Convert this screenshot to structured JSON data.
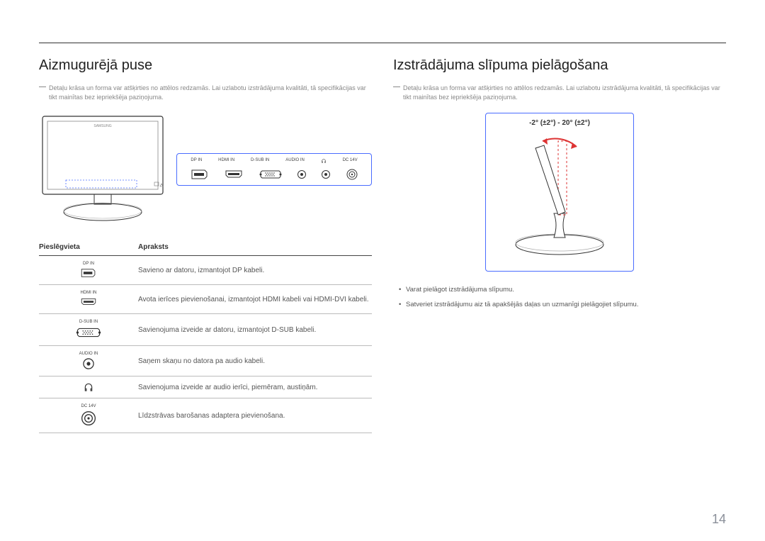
{
  "page_number": "14",
  "left": {
    "heading": "Aizmugurējā puse",
    "note": "Detaļu krāsa un forma var atšķirties no attēlos redzamās. Lai uzlabotu izstrādājuma kvalitāti, tā specifikācijas var tikt mainītas bez iepriekšēja paziņojuma.",
    "port_panel_labels": {
      "dp": "DP IN",
      "hdmi": "HDMI IN",
      "dsub": "D-SUB IN",
      "audio": "AUDIO IN",
      "headphone": "",
      "dc": "DC 14V"
    },
    "table": {
      "header_port": "Pieslēgvieta",
      "header_desc": "Apraksts",
      "rows": [
        {
          "label": "DP IN",
          "desc": "Savieno ar datoru, izmantojot DP kabeli."
        },
        {
          "label": "HDMI IN",
          "desc": "Avota ierīces pievienošanai, izmantojot HDMI kabeli vai HDMI-DVI kabeli."
        },
        {
          "label": "D-SUB IN",
          "desc": "Savienojuma izveide ar datoru, izmantojot D-SUB kabeli."
        },
        {
          "label": "AUDIO IN",
          "desc": "Saņem skaņu no datora pa audio kabeli."
        },
        {
          "label": "",
          "desc": "Savienojuma izveide ar audio ierīci, piemēram, austiņām."
        },
        {
          "label": "DC 14V",
          "desc": "Līdzstrāvas barošanas adaptera pievienošana."
        }
      ]
    }
  },
  "right": {
    "heading": "Izstrādājuma slīpuma pielāgošana",
    "note": "Detaļu krāsa un forma var atšķirties no attēlos redzamās. Lai uzlabotu izstrādājuma kvalitāti, tā specifikācijas var tikt mainītas bez iepriekšēja paziņojuma.",
    "tilt_range": "-2° (±2°) - 20° (±2°)",
    "bullets": [
      "Varat pielāgot izstrādājuma slīpumu.",
      "Satveriet izstrādājumu aiz tā apakšējās daļas un uzmanīgi pielāgojiet slīpumu."
    ]
  }
}
